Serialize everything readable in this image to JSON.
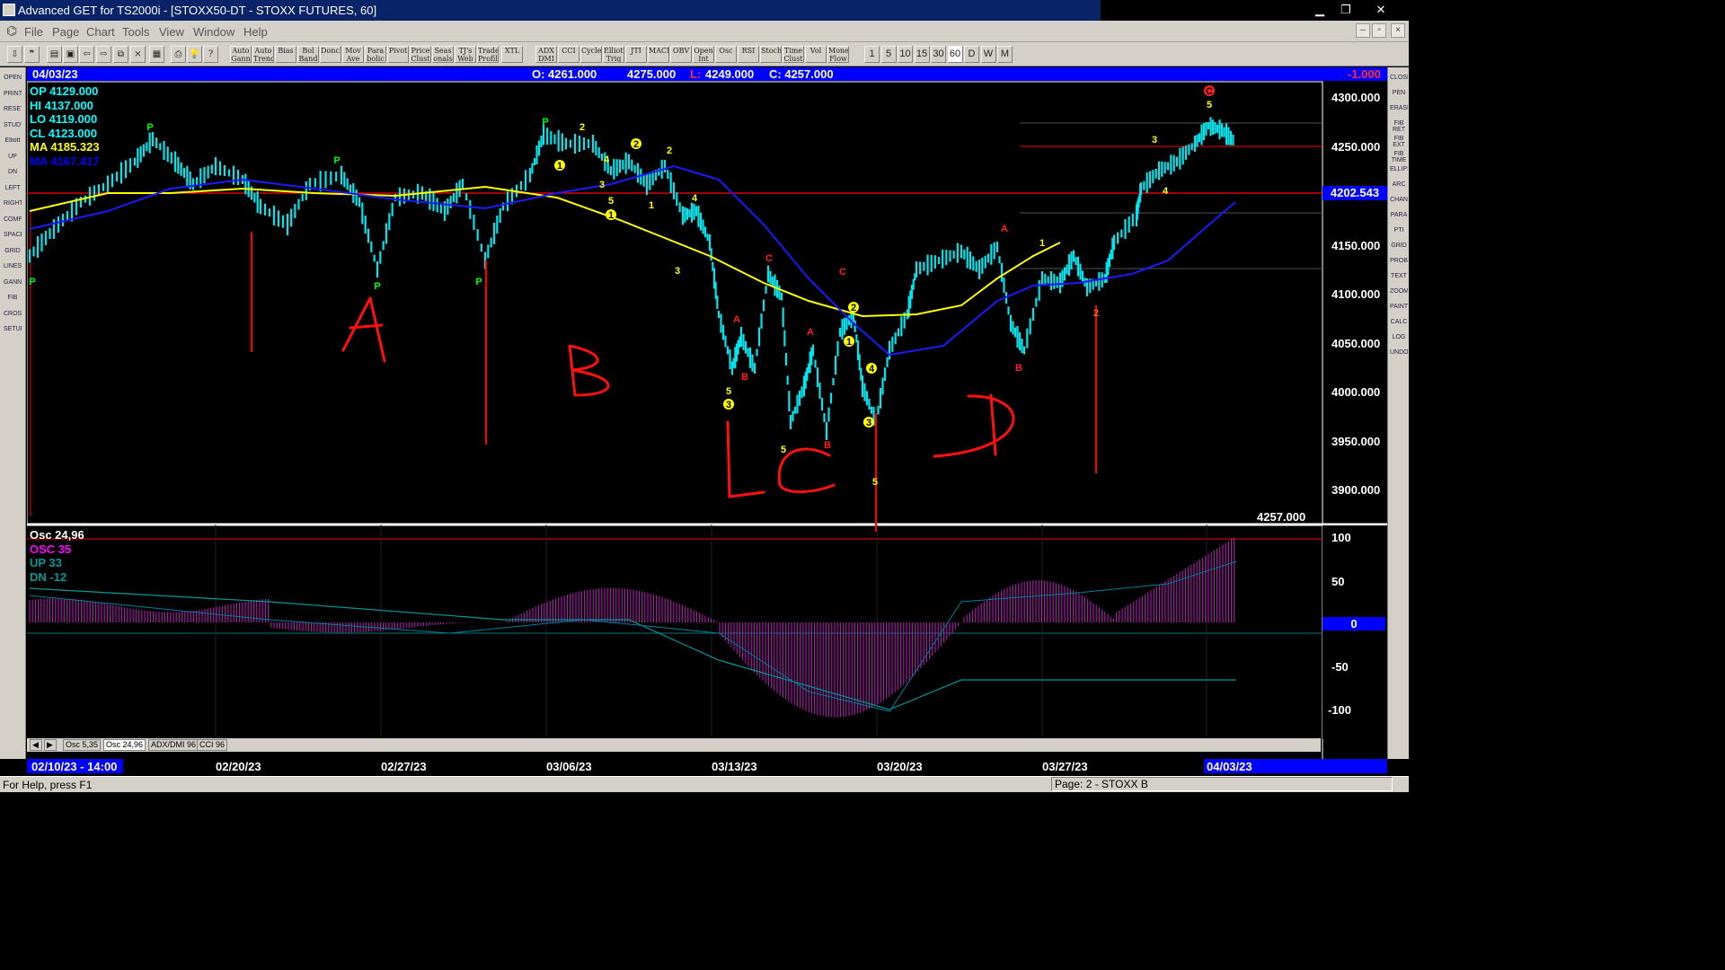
{
  "window": {
    "title": "Advanced GET for TS2000i - [STOXX50-DT - STOXX FUTURES, 60]",
    "minimize": "▁",
    "restore": "❐",
    "close": "✕"
  },
  "menu": [
    "File",
    "Page",
    "Chart",
    "Tools",
    "View",
    "Window",
    "Help"
  ],
  "mdi": {
    "minimize": "–",
    "restore": "▫",
    "close": "×"
  },
  "toolbar_text_buttons": [
    "Auto Gann",
    "Auto Trend",
    "Bias",
    "Bol Band",
    "Donch",
    "Mov Ave",
    "Para bolic",
    "Pivot",
    "Price Clust",
    "Seas onals",
    "TJ's Web",
    "Trade Profile",
    "XTL",
    "ADX DMI",
    "CCI",
    "Cycles",
    "Elliott Trig",
    "JTI",
    "MACD",
    "OBV",
    "Open Int",
    "Osc",
    "RSI",
    "Stoch",
    "Time Clust",
    "Vol",
    "Money Flow"
  ],
  "timeframes": [
    "1",
    "5",
    "10",
    "15",
    "30",
    "60",
    "D",
    "W",
    "M"
  ],
  "left_tools": [
    "OPEN",
    "PRINT",
    "RESET",
    "STUDY",
    "Elliott",
    "UP",
    "DN",
    "LEFT",
    "RIGHT",
    "COMP",
    "SPACE",
    "GRID",
    "LINES",
    "GANN",
    "FIB",
    "CROSS",
    "SETUP"
  ],
  "right_tools": [
    "CLOSE",
    "PEN",
    "ERASE",
    "FIB RET",
    "FIB EXT",
    "FIB TIME",
    "ELLIPSE",
    "ARC",
    "CHAN",
    "PARA",
    "PTI",
    "GRID",
    "PROB",
    "TEXT",
    "ZOOM",
    "PAINT",
    "CALC",
    "LOG",
    "UNDO"
  ],
  "header": {
    "date": "04/03/23",
    "open": "O: 4261.000",
    "high": "4275.000",
    "low_label": "L:",
    "low": "4249.000",
    "close": "C: 4257.000",
    "change": "-1.000"
  },
  "ohlc_panel": [
    {
      "label": "OP  4129.000",
      "color": "#00ffff"
    },
    {
      "label": "HI   4137.000",
      "color": "#00ffff"
    },
    {
      "label": "LO  4119.000",
      "color": "#00ffff"
    },
    {
      "label": "CL  4123.000",
      "color": "#00ffff"
    },
    {
      "label": "MA  4185.323",
      "color": "#ffff00"
    },
    {
      "label": "MA  4167.417",
      "color": "#0000ff"
    }
  ],
  "price_axis": [
    "4300.000",
    "4250.000",
    "4202.543",
    "4150.000",
    "4100.000",
    "4050.000",
    "4000.000",
    "3950.000",
    "3900.000"
  ],
  "last_price": "4257.000",
  "osc_panel": [
    {
      "label": "Osc 24,96",
      "color": "#ffffff"
    },
    {
      "label": "OSC 35",
      "color": "#ff00ff"
    },
    {
      "label": "UP   33",
      "color": "#009999"
    },
    {
      "label": "DN   -12",
      "color": "#009999"
    }
  ],
  "osc_axis": [
    "100",
    "50",
    "0",
    "-50",
    "-100"
  ],
  "tabs": [
    "Osc 5,35",
    "Osc 24,96",
    "ADX/DMI 96",
    "CCI 96"
  ],
  "dates": [
    "02/10/23 - 14:00",
    "02/20/23",
    "02/27/23",
    "03/06/23",
    "03/13/23",
    "03/20/23",
    "03/27/23",
    "04/03/23"
  ],
  "status": {
    "help": "For Help, press F1",
    "page": "Page: 2 - STOXX B"
  },
  "annotations": {
    "handwritten": [
      "A",
      "B",
      "C",
      "D"
    ]
  },
  "markers": [
    {
      "t": "P",
      "c": "#00ff00"
    },
    {
      "t": "P",
      "c": "#00ff00"
    },
    {
      "t": "P",
      "c": "#00ff00"
    },
    {
      "t": "P",
      "c": "#00ff00"
    },
    {
      "t": "P",
      "c": "#00ff00"
    },
    {
      "t": "P",
      "c": "#00ff00"
    },
    {
      "t": "2",
      "c": "#ffff00"
    },
    {
      "t": "1",
      "c": "#ffff00"
    },
    {
      "t": "4",
      "c": "#ffff00"
    },
    {
      "t": "3",
      "c": "#ffff00"
    },
    {
      "t": "5",
      "c": "#ffff00"
    },
    {
      "t": "2",
      "c": "#ffff00"
    },
    {
      "t": "1",
      "c": "#ffff00"
    },
    {
      "t": "2",
      "c": "#ffff00"
    },
    {
      "t": "1",
      "c": "#ffff00"
    },
    {
      "t": "4",
      "c": "#ffff00"
    },
    {
      "t": "3",
      "c": "#ffff00"
    },
    {
      "t": "4",
      "c": "#ffff00"
    },
    {
      "t": "C",
      "c": "#ff2020"
    },
    {
      "t": "A",
      "c": "#ff2020"
    },
    {
      "t": "B",
      "c": "#ff2020"
    },
    {
      "t": "5",
      "c": "#ffff00"
    },
    {
      "t": "3",
      "c": "#ffff00"
    },
    {
      "t": "5",
      "c": "#ffff00"
    },
    {
      "t": "A",
      "c": "#ff2020"
    },
    {
      "t": "B",
      "c": "#ff2020"
    },
    {
      "t": "C",
      "c": "#ff2020"
    },
    {
      "t": "2",
      "c": "#ffff00"
    },
    {
      "t": "1",
      "c": "#ffff00"
    },
    {
      "t": "4",
      "c": "#ffff00"
    },
    {
      "t": "3",
      "c": "#ffff00"
    },
    {
      "t": "5",
      "c": "#ffff00"
    },
    {
      "t": "A",
      "c": "#ff2020"
    },
    {
      "t": "B",
      "c": "#ff2020"
    },
    {
      "t": "1",
      "c": "#ffff00"
    },
    {
      "t": "2",
      "c": "#ff6010"
    },
    {
      "t": "3",
      "c": "#ffff00"
    },
    {
      "t": "4",
      "c": "#ffff00"
    },
    {
      "t": "5",
      "c": "#ffff00"
    },
    {
      "t": "C",
      "c": "#ff2020"
    }
  ]
}
